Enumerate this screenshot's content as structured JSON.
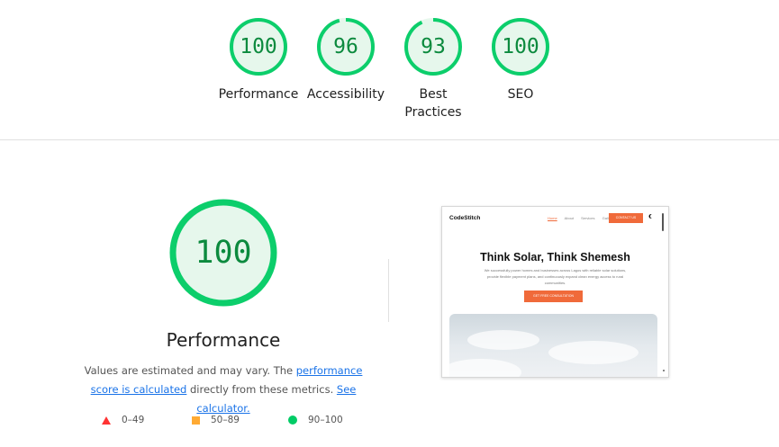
{
  "categories": [
    {
      "score": "100",
      "label": "Performance",
      "fraction": 1.0
    },
    {
      "score": "96",
      "label": "Accessibility",
      "fraction": 0.96
    },
    {
      "score": "93",
      "label": "Best Practices",
      "fraction": 0.93
    },
    {
      "score": "100",
      "label": "SEO",
      "fraction": 1.0
    }
  ],
  "main": {
    "score": "100",
    "fraction": 1.0,
    "title": "Performance",
    "desc_prefix": "Values are estimated and may vary. The ",
    "score_link": "performance score is calculated",
    "desc_middle": " directly from these metrics. ",
    "calc_link": "See calculator."
  },
  "legend": [
    {
      "icon": "red-triangle",
      "text": "0–49"
    },
    {
      "icon": "orange-square",
      "text": "50–89"
    },
    {
      "icon": "green-circle",
      "text": "90–100"
    }
  ],
  "colors": {
    "pass": "#0c8a3e",
    "ring": "#0cce6b",
    "ring_bg": "#e6f7ec",
    "fail": "#ff3333",
    "average": "#ffaa33",
    "good": "#00cc66"
  },
  "screenshot": {
    "logo": "CodeStitch",
    "nav_links": [
      "Home",
      "About",
      "Services",
      "Gallery"
    ],
    "contact": "CONTACT US",
    "heading": "Think Solar, Think Shemesh",
    "body": "We successfully power homes and businesses across Lagos with reliable solar solutions, provide flexible payment plans, and continuously expand clean energy access to rural communities.",
    "cta": "GET FREE CONSULTATION"
  }
}
